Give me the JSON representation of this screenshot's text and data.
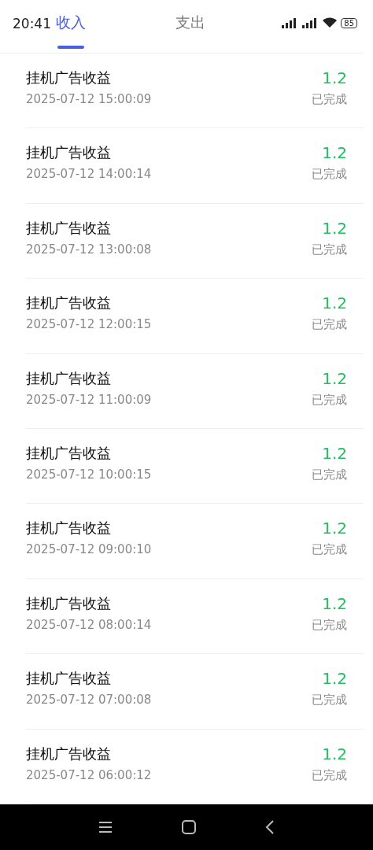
{
  "status_bar": {
    "time": "20:41",
    "battery": "85"
  },
  "tabs": [
    {
      "label": "收入",
      "selected": true
    },
    {
      "label": "支出",
      "selected": false
    }
  ],
  "records": [
    {
      "title": "挂机广告收益",
      "time": "2025-07-12 15:00:09",
      "amount": "1.2",
      "status": "已完成"
    },
    {
      "title": "挂机广告收益",
      "time": "2025-07-12 14:00:14",
      "amount": "1.2",
      "status": "已完成"
    },
    {
      "title": "挂机广告收益",
      "time": "2025-07-12 13:00:08",
      "amount": "1.2",
      "status": "已完成"
    },
    {
      "title": "挂机广告收益",
      "time": "2025-07-12 12:00:15",
      "amount": "1.2",
      "status": "已完成"
    },
    {
      "title": "挂机广告收益",
      "time": "2025-07-12 11:00:09",
      "amount": "1.2",
      "status": "已完成"
    },
    {
      "title": "挂机广告收益",
      "time": "2025-07-12 10:00:15",
      "amount": "1.2",
      "status": "已完成"
    },
    {
      "title": "挂机广告收益",
      "time": "2025-07-12 09:00:10",
      "amount": "1.2",
      "status": "已完成"
    },
    {
      "title": "挂机广告收益",
      "time": "2025-07-12 08:00:14",
      "amount": "1.2",
      "status": "已完成"
    },
    {
      "title": "挂机广告收益",
      "time": "2025-07-12 07:00:08",
      "amount": "1.2",
      "status": "已完成"
    },
    {
      "title": "挂机广告收益",
      "time": "2025-07-12 06:00:12",
      "amount": "1.2",
      "status": "已完成"
    }
  ]
}
